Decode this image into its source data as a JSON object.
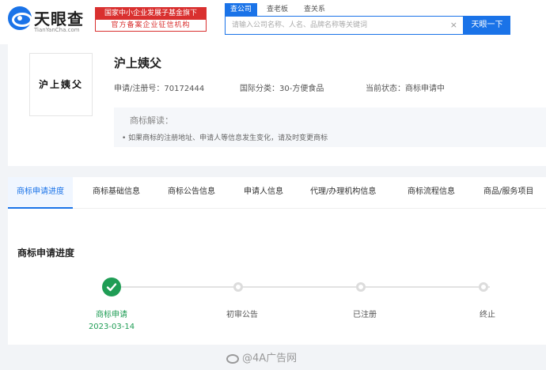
{
  "brand": {
    "name": "天眼查",
    "domain": "TianYanCha.com",
    "gov_badge_line1": "国家中小企业发展子基金旗下",
    "gov_badge_line2": "官方备案企业征信机构"
  },
  "search": {
    "tabs": [
      "查公司",
      "查老板",
      "查关系"
    ],
    "active_tab": 0,
    "placeholder": "请输入公司名称、人名、品牌名称等关键词",
    "value": "",
    "clear_icon": "×",
    "button_label": "天眼一下"
  },
  "trademark": {
    "image_text": "沪上姨父",
    "name": "沪上姨父",
    "reg_no_label": "申请/注册号：",
    "reg_no": "70172444",
    "class_label": "国际分类：",
    "class": "30-方便食品",
    "status_label": "当前状态：",
    "status": "商标申请中",
    "explain_title": "商标解读：",
    "explain_items": [
      "如果商标的注册地址、申请人等信息发生变化，请及时变更商标"
    ]
  },
  "tabs": [
    "商标申请进度",
    "商标基础信息",
    "商标公告信息",
    "申请人信息",
    "代理/办理机构信息",
    "商标流程信息",
    "商品/服务项目"
  ],
  "active_tab": 0,
  "progress": {
    "title": "商标申请进度",
    "steps": [
      {
        "label": "商标申请",
        "date": "2023-03-14",
        "done": true
      },
      {
        "label": "初审公告",
        "done": false
      },
      {
        "label": "已注册",
        "done": false
      },
      {
        "label": "终止",
        "done": false
      }
    ]
  },
  "colors": {
    "accent": "#1a73e8",
    "success": "#1f9d55",
    "badge_red": "#d9302f"
  },
  "watermark": "@4A广告网"
}
